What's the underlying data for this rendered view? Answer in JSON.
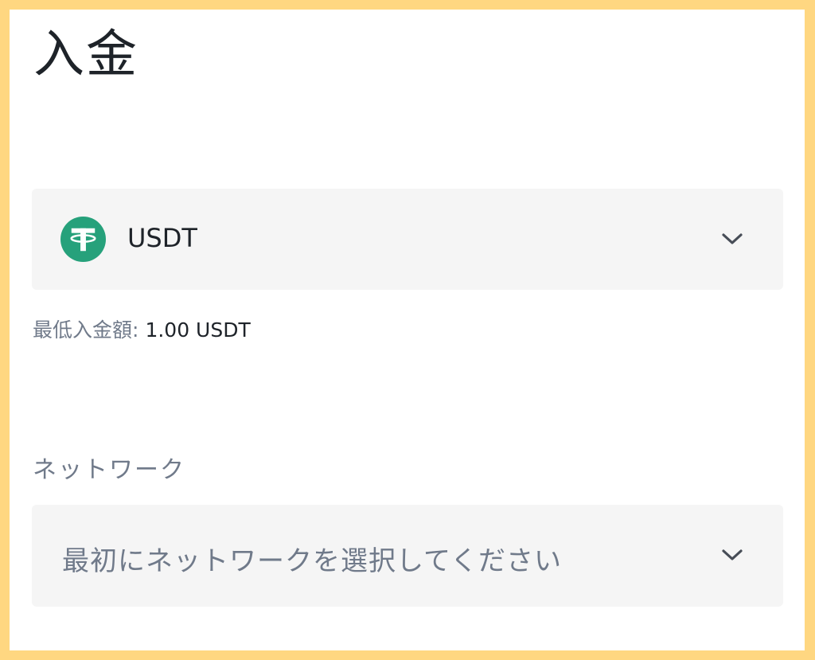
{
  "page": {
    "title": "入金"
  },
  "coin_select": {
    "selected": "USDT",
    "icon": "tether-icon",
    "icon_color": "#26a17b"
  },
  "min_deposit": {
    "label": "最低入金額:",
    "value": "1.00 USDT"
  },
  "network": {
    "label": "ネットワーク",
    "placeholder": "最初にネットワークを選択してください"
  }
}
